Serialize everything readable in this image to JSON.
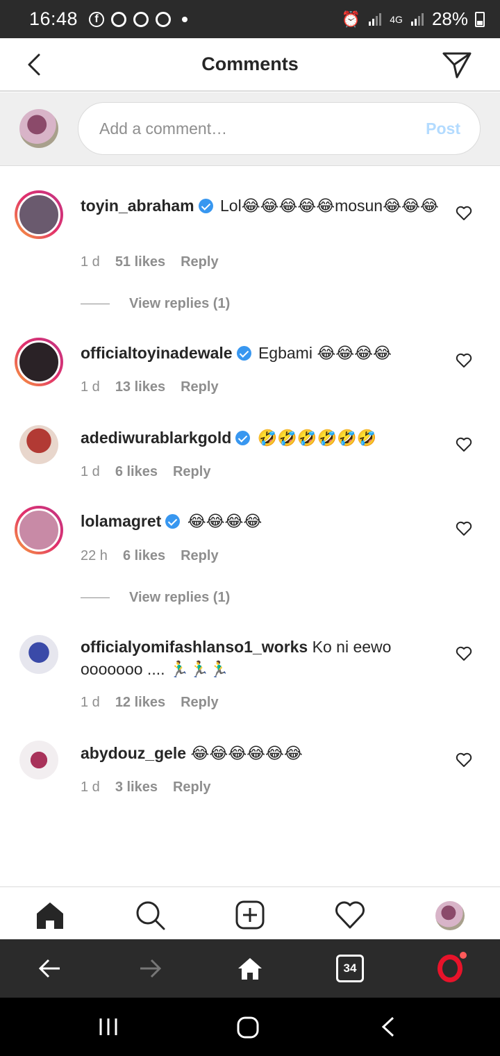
{
  "status_bar": {
    "time": "16:48",
    "network": "4G",
    "battery": "28%"
  },
  "header": {
    "title": "Comments"
  },
  "composer": {
    "placeholder": "Add a comment…",
    "post_label": "Post"
  },
  "comments": [
    {
      "username": "toyin_abraham",
      "verified": true,
      "text": " Lol😂😂😂😂😂mosun😂😂😂",
      "time": "1 d",
      "likes": "51 likes",
      "reply": "Reply",
      "view_replies": "View replies (1)",
      "avatar_color": "#6a5a6e"
    },
    {
      "username": "officialtoyinadewale",
      "verified": true,
      "text": " Egbami 😂😂😂😂",
      "time": "1 d",
      "likes": "13 likes",
      "reply": "Reply",
      "avatar_color": "#2a2226"
    },
    {
      "username": "adediwurablarkgold",
      "verified": true,
      "text": " 🤣🤣🤣🤣🤣🤣",
      "time": "1 d",
      "likes": "6 likes",
      "reply": "Reply",
      "avatar_color": "#b23a34"
    },
    {
      "username": "lolamagret",
      "verified": true,
      "text": " 😂😂😂😂",
      "time": "22 h",
      "likes": "6 likes",
      "reply": "Reply",
      "view_replies": "View replies (1)",
      "avatar_color": "#c88aa6"
    },
    {
      "username": "officialyomifashlanso1_works",
      "verified": false,
      "text": " Ko ni eewo ooooooo .... 🏃‍♂️🏃‍♂️🏃‍♂️",
      "time": "1 d",
      "likes": "12 likes",
      "reply": "Reply",
      "avatar_color": "#3a4aa8"
    },
    {
      "username": "abydouz_gele",
      "verified": false,
      "text": " 😂😂😂😂😂😂",
      "time": "1 d",
      "likes": "3 likes",
      "reply": "Reply",
      "avatar_color": "#a8325a"
    }
  ],
  "browser_bar": {
    "tab_count": "34"
  },
  "colors": {
    "accent": "#3897f0",
    "post_disabled": "#b3dbff",
    "meta_gray": "#8e8e8e",
    "opera_red": "#e8132a"
  }
}
